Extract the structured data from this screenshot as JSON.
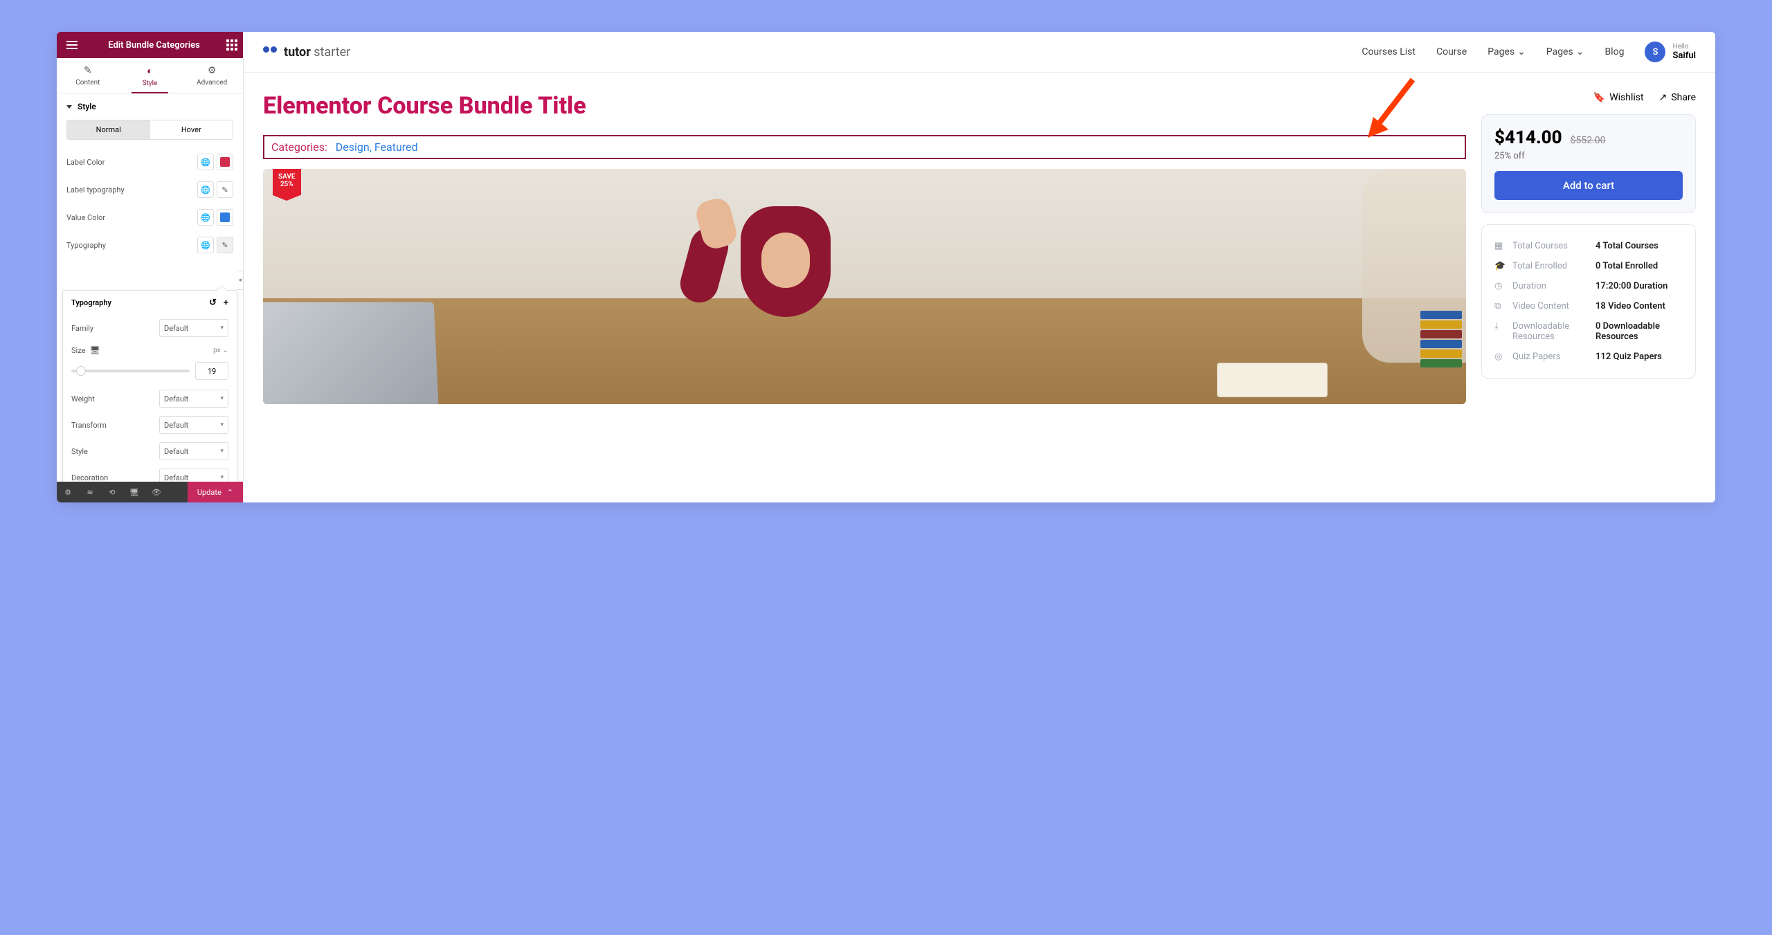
{
  "sidebar": {
    "title": "Edit Bundle Categories",
    "tabs": {
      "content": "Content",
      "style": "Style",
      "advanced": "Advanced"
    },
    "section_label": "Style",
    "state": {
      "normal": "Normal",
      "hover": "Hover"
    },
    "controls": {
      "label_color": "Label Color",
      "label_typography": "Label typography",
      "value_color": "Value Color",
      "typography": "Typography"
    },
    "popover": {
      "title": "Typography",
      "family": "Family",
      "family_value": "Default",
      "size": "Size",
      "size_unit": "px",
      "size_value": "19",
      "weight": "Weight",
      "weight_value": "Default",
      "transform": "Transform",
      "transform_value": "Default",
      "style": "Style",
      "style_value": "Default",
      "decoration": "Decoration",
      "decoration_value": "Default"
    },
    "footer": {
      "update": "Update"
    }
  },
  "site": {
    "logo_bold": "tutor",
    "logo_light": "starter",
    "nav": [
      "Courses List",
      "Course",
      "Pages",
      "Pages",
      "Blog"
    ],
    "user": {
      "initial": "S",
      "hello": "Hello",
      "name": "Saiful"
    }
  },
  "bundle": {
    "title": "Elementor Course Bundle Title",
    "categories_label": "Categories:",
    "categories": [
      "Design",
      "Featured"
    ],
    "save_label": "SAVE",
    "save_pct": "25%"
  },
  "actions": {
    "wishlist": "Wishlist",
    "share": "Share"
  },
  "price": {
    "current": "$414.00",
    "original": "$552.00",
    "discount": "25% off",
    "add_to_cart": "Add to cart"
  },
  "meta": [
    {
      "icon": "courses",
      "label": "Total Courses",
      "value": "4 Total Courses"
    },
    {
      "icon": "enrolled",
      "label": "Total Enrolled",
      "value": "0 Total Enrolled"
    },
    {
      "icon": "duration",
      "label": "Duration",
      "value": "17:20:00 Duration"
    },
    {
      "icon": "video",
      "label": "Video Content",
      "value": "18 Video Content"
    },
    {
      "icon": "download",
      "label": "Downloadable Resources",
      "value": "0 Downloadable Resources"
    },
    {
      "icon": "quiz",
      "label": "Quiz Papers",
      "value": "112 Quiz Papers"
    }
  ]
}
